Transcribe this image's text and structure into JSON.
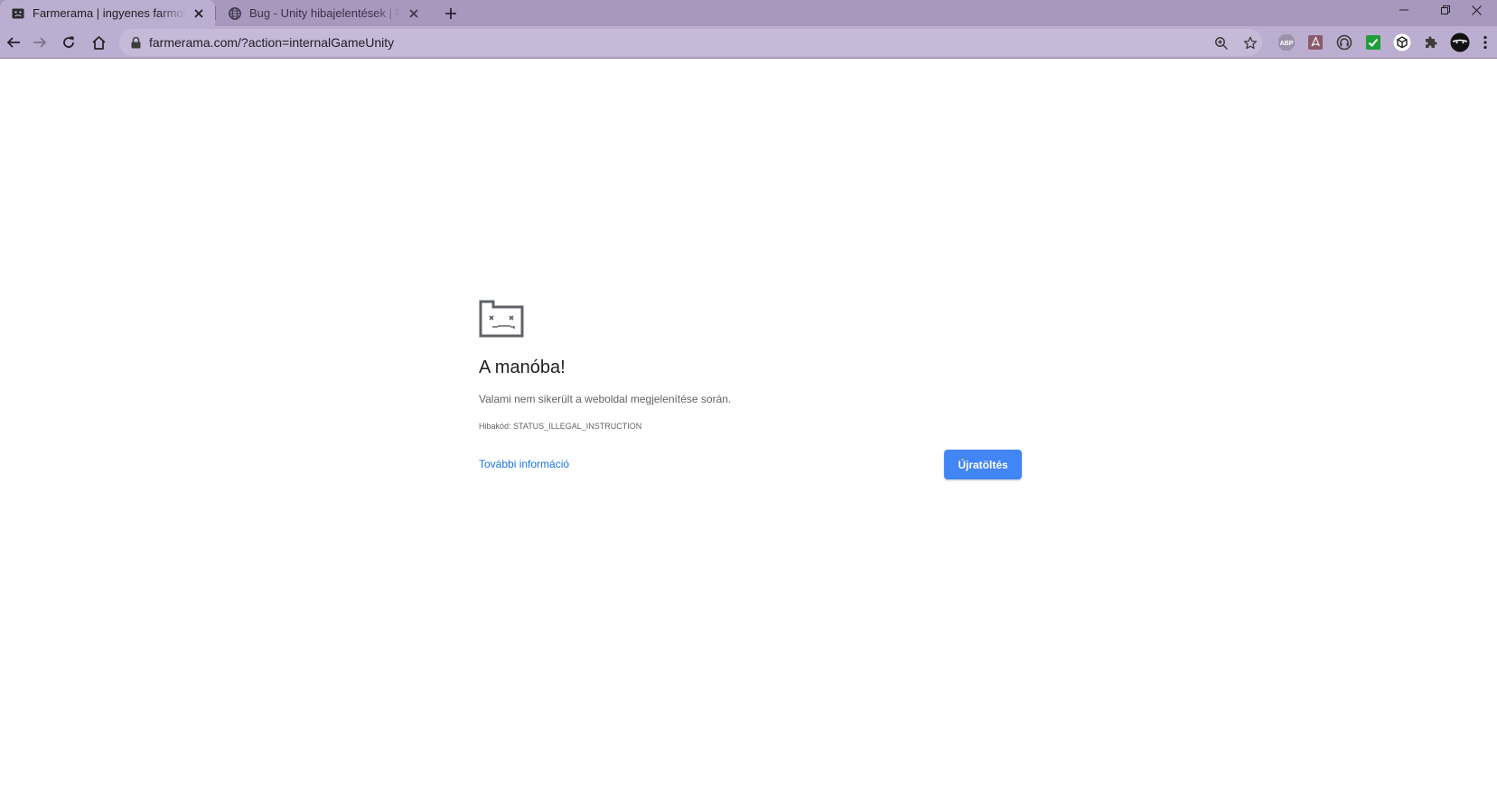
{
  "browser": {
    "tabs": [
      {
        "title": "Farmerama | ingyenes farmos játék",
        "icon": "farmerama-favicon-icon",
        "active": true
      },
      {
        "title": "Bug - Unity hibajelentések | Farmerama",
        "icon": "globe-icon",
        "active": false
      }
    ],
    "new_tab_icon": "plus-icon",
    "window_controls": [
      "minimize-icon",
      "restore-icon",
      "close-icon"
    ],
    "url": "farmerama.com/?action=internalGameUnity",
    "extensions": {
      "abp_label": "ABP"
    },
    "colors": {
      "frame": "#a898bd",
      "toolbar": "#bbaed0",
      "omnibox": "#c7bad9",
      "accent_button": "#4285f4",
      "link": "#1a73e8"
    }
  },
  "error_page": {
    "icon": "sad-tab-icon",
    "title": "A manóba!",
    "description": "Valami nem sikerült a weboldal megjelenítése során.",
    "error_code": "Hibakód: STATUS_ILLEGAL_INSTRUCTION",
    "more_info_link": "További információ",
    "reload_button": "Újratöltés"
  }
}
